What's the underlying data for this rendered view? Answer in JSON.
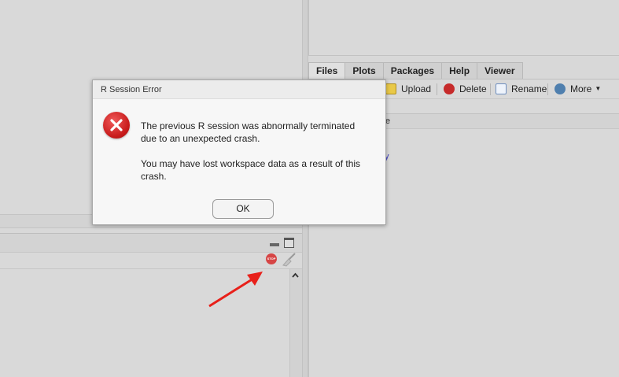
{
  "files_pane": {
    "tabs": [
      "Files",
      "Plots",
      "Packages",
      "Help",
      "Viewer"
    ],
    "toolbar": {
      "upload": "Upload",
      "delete": "Delete",
      "rename": "Rename",
      "more": "More"
    },
    "header_fragment": "e",
    "link_fragment": "y"
  },
  "console": {
    "stop_label": "STOP"
  },
  "dialog": {
    "title": "R Session Error",
    "message_1": "The previous R session was abnormally terminated due to an unexpected crash.",
    "message_2": "You may have lost workspace data as a result of this crash.",
    "ok_label": "OK"
  },
  "colors": {
    "annotation_arrow": "#e8201a",
    "error_red": "#d42a2a"
  }
}
